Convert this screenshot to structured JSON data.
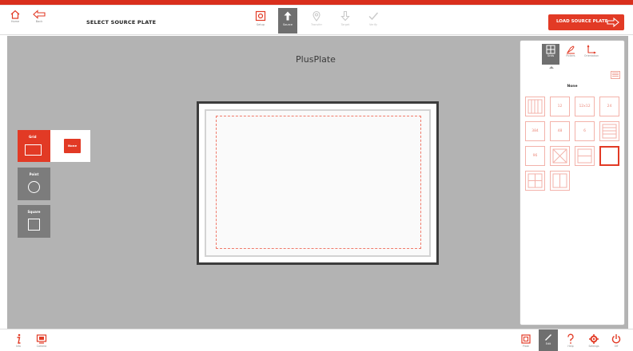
{
  "header": {
    "home_label": "Home",
    "back_label": "Back",
    "title": "SELECT SOURCE PLATE",
    "steps": [
      {
        "label": "Setup",
        "icon": "plate-setup-icon"
      },
      {
        "label": "Source",
        "icon": "up-arrow-icon"
      },
      {
        "label": "Transfer",
        "icon": "location-pin-icon"
      },
      {
        "label": "Target",
        "icon": "down-arrow-icon"
      },
      {
        "label": "Verify",
        "icon": "checkmark-icon"
      }
    ],
    "load_button": "LOAD SOURCE PLATE"
  },
  "plate": {
    "title": "PlusPlate"
  },
  "tools": {
    "grid_label": "Grid",
    "none_label": "None",
    "point_label": "Point",
    "square_label": "Square"
  },
  "right_panel": {
    "tabs": [
      {
        "label": "Grids"
      },
      {
        "label": "Pickers"
      },
      {
        "label": "Orientation"
      }
    ],
    "section_title": "None",
    "grid_tiles": [
      "",
      "12",
      "12x12",
      "24",
      "384",
      "48",
      "6",
      "",
      "96",
      "",
      "",
      "",
      "",
      ""
    ]
  },
  "bottom": {
    "info_label": "Info",
    "camera_label": "Camera",
    "right_items": [
      {
        "label": "Plate"
      },
      {
        "label": "Edit"
      },
      {
        "label": "Help"
      },
      {
        "label": "Settings"
      },
      {
        "label": "Off"
      }
    ]
  },
  "colors": {
    "accent": "#e23a25",
    "workspace": "#b3b3b3",
    "active_tab": "#6f6f6f"
  }
}
